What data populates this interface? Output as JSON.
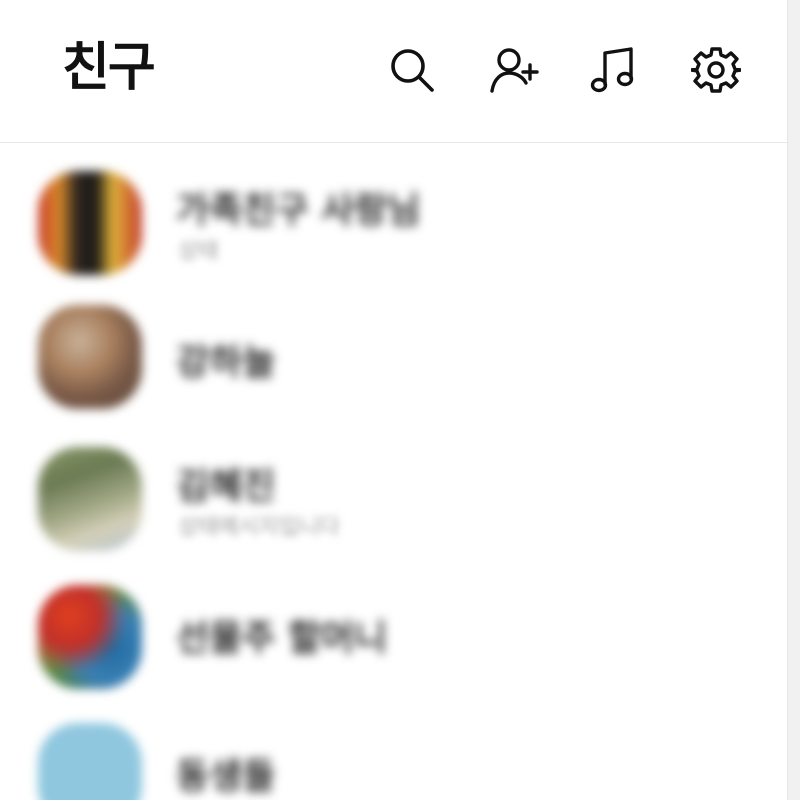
{
  "header": {
    "title": "친구",
    "icons": {
      "search": "search-icon",
      "add_friend": "add-friend-icon",
      "music": "music-note-icon",
      "settings": "gear-icon"
    }
  },
  "friends": [
    {
      "name": "가족친구 사랑님",
      "status": "상태"
    },
    {
      "name": "강하늘",
      "status": ""
    },
    {
      "name": "김혜진",
      "status": "상태메시지입니다"
    },
    {
      "name": "선물주 할머니",
      "status": ""
    },
    {
      "name": "동생들",
      "status": ""
    }
  ],
  "colors": {
    "background": "#ffffff",
    "divider": "#e8e8e8",
    "title": "#121212"
  }
}
